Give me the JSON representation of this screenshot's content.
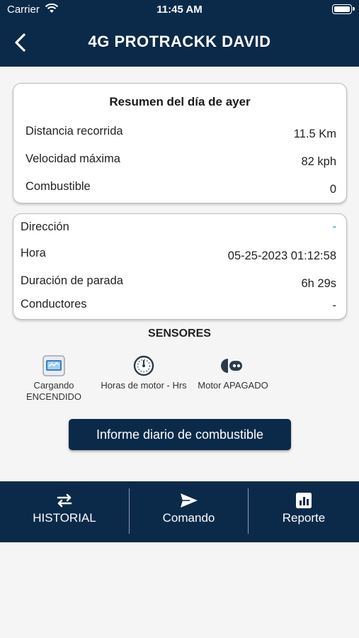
{
  "status_bar": {
    "carrier": "Carrier",
    "time": "11:45 AM"
  },
  "header": {
    "title": "4G PROTRACKK DAVID"
  },
  "summary": {
    "title": "Resumen del día de ayer",
    "rows": [
      {
        "label": "Distancia recorrida",
        "value": "11.5 Km"
      },
      {
        "label": "Velocidad máxima",
        "value": "82 kph"
      },
      {
        "label": "Combustible",
        "value": "0"
      }
    ]
  },
  "details": {
    "rows": [
      {
        "label": "Dirección",
        "value": "-"
      },
      {
        "label": "Hora",
        "value": "05-25-2023 01:12:58"
      },
      {
        "label": "Duración de parada",
        "value": "6h 29s"
      },
      {
        "label": "Conductores",
        "value": "-"
      }
    ]
  },
  "sensors": {
    "title": "SENSORES",
    "items": [
      {
        "label": "Cargando ENCENDIDO",
        "icon": "charging-icon"
      },
      {
        "label": "Horas de motor - Hrs",
        "icon": "gauge-icon"
      },
      {
        "label": "Motor APAGADO",
        "icon": "ignition-key-icon"
      }
    ]
  },
  "fuel_button": {
    "label": "Informe diario de combustible"
  },
  "bottom_nav": {
    "items": [
      {
        "label": "HISTORIAL",
        "icon": "history-icon"
      },
      {
        "label": "Comando",
        "icon": "send-icon"
      },
      {
        "label": "Reporte",
        "icon": "report-icon"
      }
    ]
  },
  "colors": {
    "primary": "#0b2a4a",
    "link": "#2e8fd6",
    "background": "#f5f5f5"
  }
}
